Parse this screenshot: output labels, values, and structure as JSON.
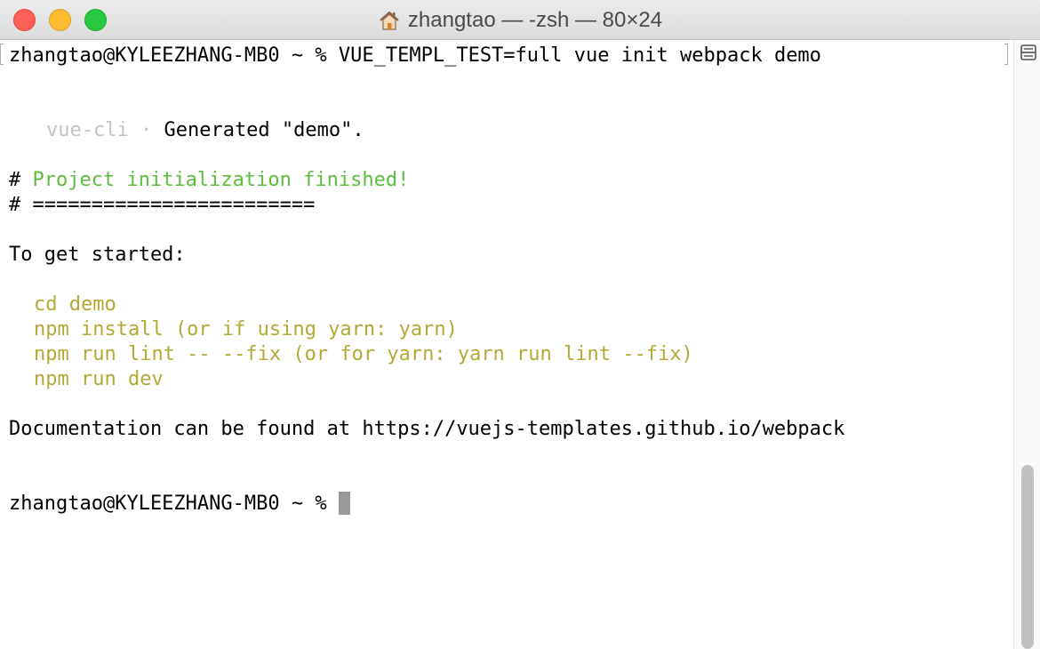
{
  "window": {
    "title": "zhangtao — -zsh — 80×24",
    "title_icon": "home-icon"
  },
  "terminal": {
    "command_prompt": "zhangtao@KYLEEZHANG-MB0 ~ % ",
    "command": "VUE_TEMPL_TEST=full vue init webpack demo",
    "generated_prefix": "vue-cli",
    "generated_sep": " · ",
    "generated_text": "Generated \"demo\".",
    "finished_hash": "# ",
    "finished_text": "Project initialization finished!",
    "divider": "# ========================",
    "started": "To get started:",
    "steps": [
      "cd demo",
      "npm install (or if using yarn: yarn)",
      "npm run lint -- --fix (or for yarn: yarn run lint --fix)",
      "npm run dev"
    ],
    "docs": "Documentation can be found at https://vuejs-templates.github.io/webpack",
    "final_prompt": "zhangtao@KYLEEZHANG-MB0 ~ % "
  },
  "colors": {
    "close": "#fe5f57",
    "minimize": "#febc2e",
    "maximize": "#28c840",
    "green_text": "#5ebd3e",
    "yellow_text": "#b3a934",
    "grey_text": "#c4c4c4"
  }
}
